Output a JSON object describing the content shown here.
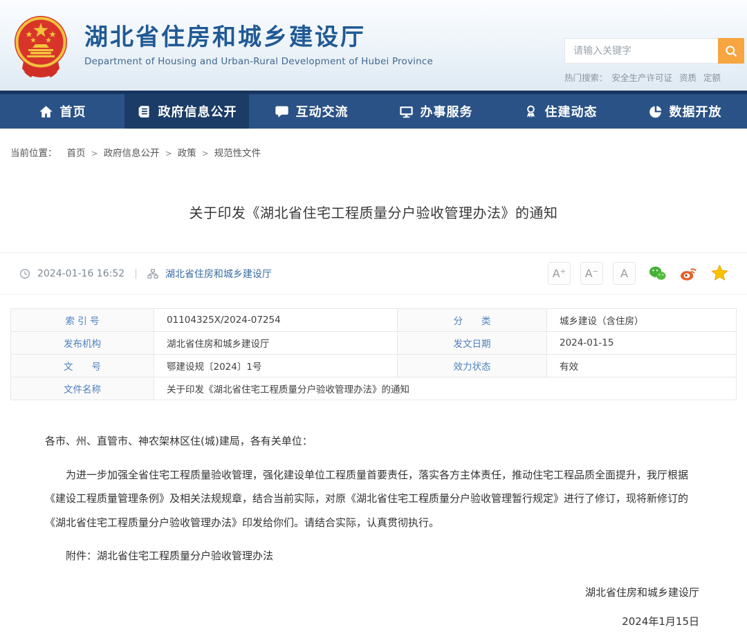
{
  "header": {
    "site_title": "湖北省住房和城乡建设厅",
    "site_subtitle": "Department of Housing and Urban-Rural Development of Hubei Province",
    "search": {
      "placeholder": "请输入关键字"
    },
    "hot_search": {
      "label": "热门搜索：",
      "items": [
        "安全生产许可证",
        "资质",
        "定额"
      ]
    }
  },
  "nav": {
    "items": [
      {
        "label": "首页",
        "icon": "home-icon",
        "active": false
      },
      {
        "label": "政府信息公开",
        "icon": "document-icon",
        "active": true
      },
      {
        "label": "互动交流",
        "icon": "chat-bubble-icon",
        "active": false
      },
      {
        "label": "办事服务",
        "icon": "monitor-icon",
        "active": false
      },
      {
        "label": "住建动态",
        "icon": "badge-icon",
        "active": false
      },
      {
        "label": "数据开放",
        "icon": "pie-chart-icon",
        "active": false
      }
    ]
  },
  "breadcrumb": {
    "label": "当前位置：",
    "separator": ">",
    "items": [
      "首页",
      "政府信息公开",
      "政策",
      "规范性文件"
    ]
  },
  "article": {
    "title": "关于印发《湖北省住宅工程质量分户验收管理办法》的通知",
    "meta": {
      "datetime": "2024-01-16 16:52",
      "separator": "|",
      "source": "湖北省住房和城乡建设厅",
      "font_buttons": [
        "A⁺",
        "A⁻",
        "A"
      ],
      "share_icons": [
        "wechat-icon",
        "weibo-icon",
        "favorite-star-icon"
      ]
    },
    "info_table": {
      "rows": [
        {
          "label": "索 引 号",
          "value": "01104325X/2024-07254",
          "label2": "分　　类",
          "value2": "城乡建设（含住房）"
        },
        {
          "label": "发布机构",
          "value": "湖北省住房和城乡建设厅",
          "label2": "发文日期",
          "value2": "2024-01-15"
        },
        {
          "label": "文　　号",
          "value": "鄂建设规〔2024〕1号",
          "label2": "效力状态",
          "value2": "有效"
        },
        {
          "label": "文件名称",
          "value": "关于印发《湖北省住宅工程质量分户验收管理办法》的通知"
        }
      ]
    },
    "body": {
      "salutation": "各市、州、直管市、神农架林区住(城)建局，各有关单位：",
      "paragraph": "为进一步加强全省住宅工程质量验收管理，强化建设单位工程质量首要责任，落实各方主体责任，推动住宅工程品质全面提升，我厅根据《建设工程质量管理条例》及相关法规规章，结合当前实际，对原《湖北省住宅工程质量分户验收管理暂行规定》进行了修订，现将新修订的《湖北省住宅工程质量分户验收管理办法》印发给你们。请结合实际，认真贯彻执行。",
      "attachment": "附件：湖北省住宅工程质量分户验收管理办法",
      "signature": "湖北省住房和城乡建设厅",
      "date": "2024年1月15日"
    }
  },
  "colors": {
    "accent_orange": "#f6a540",
    "nav_bg": "#2a5286",
    "nav_active_bg": "#1b3c66",
    "title_blue": "#205a94",
    "link_blue": "#3a6ca3",
    "table_label_blue": "#4e80bd",
    "wechat_green": "#44b036",
    "weibo_orange": "#e6622a",
    "star_yellow": "#f8c301"
  }
}
